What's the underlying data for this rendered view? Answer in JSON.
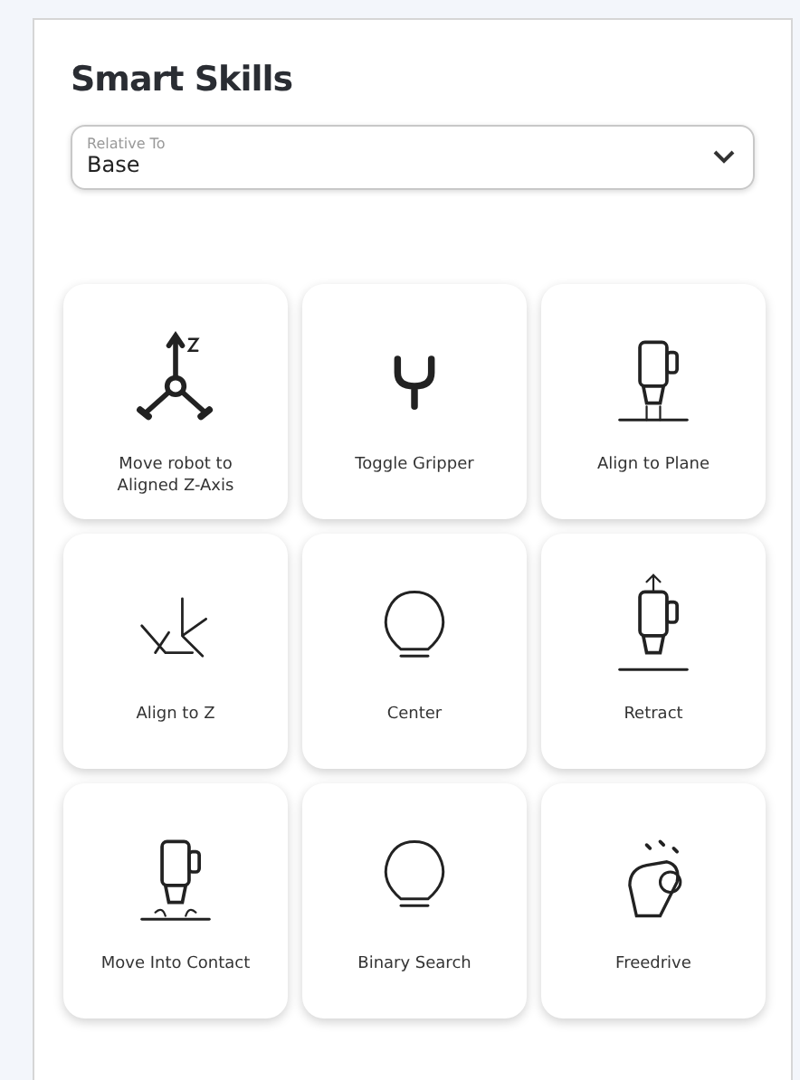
{
  "panel": {
    "title": "Smart Skills"
  },
  "relative_to": {
    "label": "Relative To",
    "value": "Base"
  },
  "skills": [
    {
      "label": "Move robot to Aligned Z-Axis",
      "kind": "axes"
    },
    {
      "label": "Toggle Gripper",
      "kind": "gripper"
    },
    {
      "label": "Align to Plane",
      "kind": "plane"
    },
    {
      "label": "Align to Z",
      "kind": "frames"
    },
    {
      "label": "Center",
      "kind": "bulb"
    },
    {
      "label": "Retract",
      "kind": "retract"
    },
    {
      "label": "Move Into Contact",
      "kind": "contact"
    },
    {
      "label": "Binary Search",
      "kind": "bulb"
    },
    {
      "label": "Freedrive",
      "kind": "hand"
    }
  ]
}
